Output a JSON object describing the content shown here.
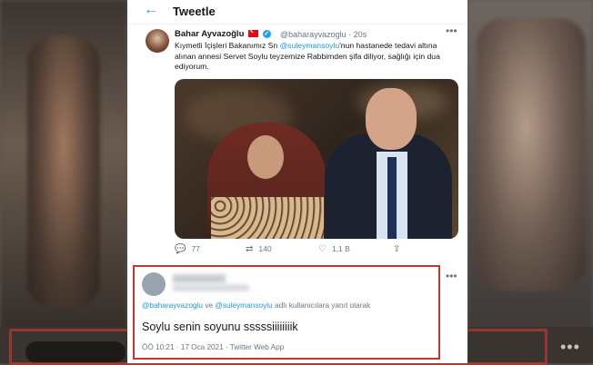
{
  "header": {
    "title": "Tweetle"
  },
  "tweet": {
    "author_name": "Bahar Ayvazoğlu",
    "handle_time": "@baharayvazoglu · 20s",
    "text_1": "Kıymetli İçişleri Bakanımız Sn ",
    "mention": "@suleymansoylu",
    "text_2": "'nun hastanede tedavi altına alınan annesi Servet Soylu teyzemize Rabbimden şifa diliyor, sağlığı için dua ediyorum.",
    "stats": {
      "replies": "77",
      "retweets": "140",
      "likes": "1,1 B"
    }
  },
  "reply": {
    "replying_mention_1": "@baharayvazoglu",
    "replying_join": " ve ",
    "replying_mention_2": "@suleymansoylu",
    "replying_suffix": " adlı kullanıcılara yanıt olarak",
    "text": "Soylu senin soyunu sssssiiiiiiiik",
    "meta": "ÖÖ 10:21 · 17 Oca 2021 · Twitter Web App"
  },
  "icons": {
    "back": "arrow-left-icon",
    "verified": "verified-icon",
    "flag": "turkey-flag-icon",
    "reply": "reply-icon",
    "retweet": "retweet-icon",
    "like": "heart-icon",
    "share": "share-icon",
    "more": "more-icon"
  },
  "colors": {
    "accent": "#1da1f2",
    "highlight_border": "#c0392b"
  }
}
